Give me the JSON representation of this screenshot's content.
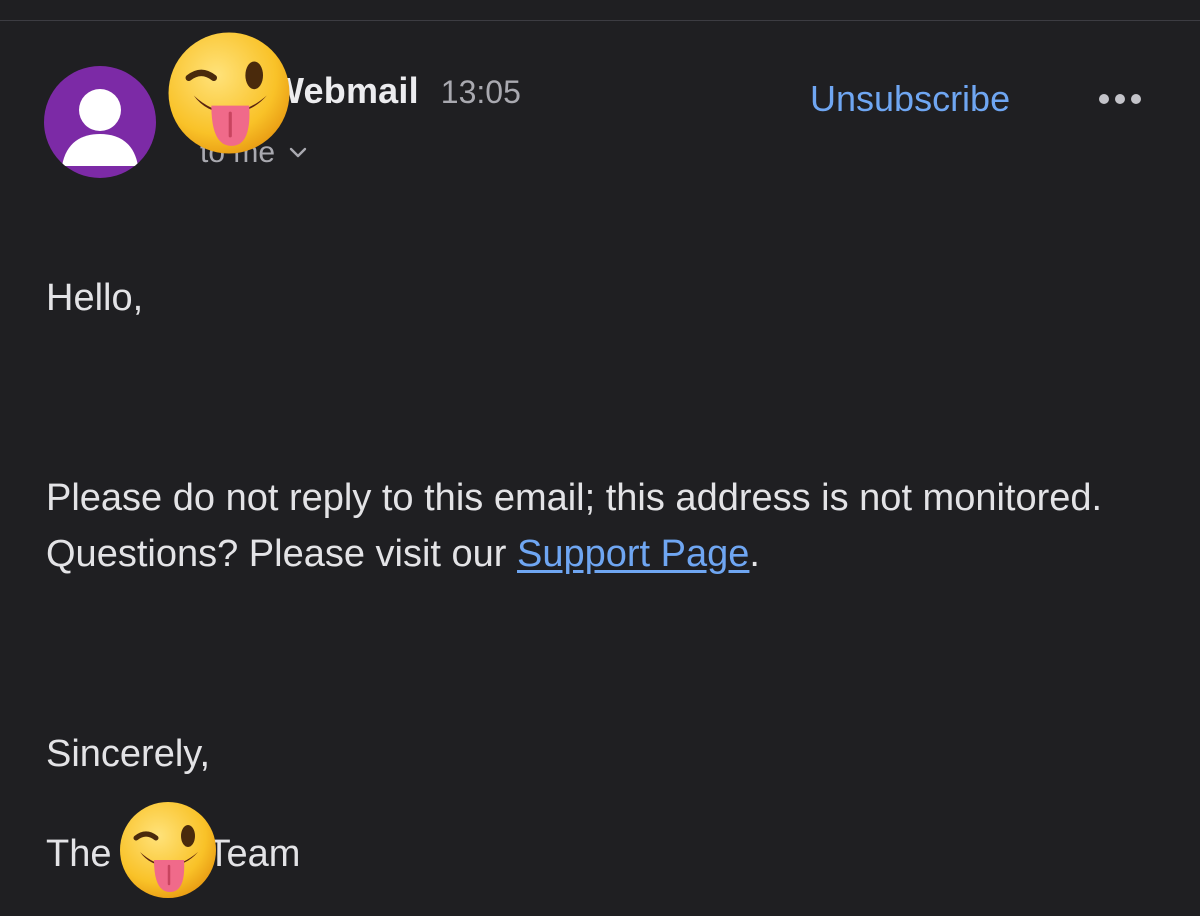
{
  "sender": {
    "name": "Webmail",
    "time": "13:05",
    "recipient": "to me"
  },
  "actions": {
    "unsubscribe_label": "Unsubscribe",
    "more_icon": "more-horizontal-icon"
  },
  "body": {
    "greeting": "Hello,",
    "paragraph_before_link": "Please do not reply to this email; this address is not monitored. Questions? Please visit our ",
    "link_text": "Support Page",
    "paragraph_after_link": ".",
    "signoff": "Sincerely,",
    "team_prefix": "The",
    "team_suffix": "Team"
  },
  "colors": {
    "background": "#1f1f22",
    "avatar": "#7c2aa6",
    "link": "#6fa6f2"
  }
}
